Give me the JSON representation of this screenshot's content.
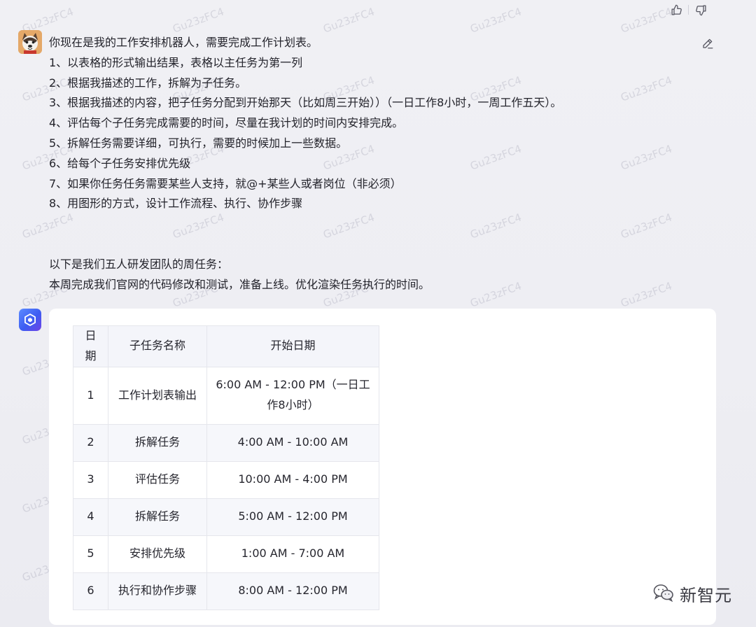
{
  "header": {
    "like_icon": "thumbs-up-icon",
    "dislike_icon": "thumbs-down-icon"
  },
  "user_message": {
    "avatar": "dog-avatar",
    "lines": [
      "你现在是我的工作安排机器人，需要完成工作计划表。",
      "1、以表格的形式输出结果，表格以主任务为第一列",
      "2、根据我描述的工作，拆解为子任务。",
      "3、根据我描述的内容，把子任务分配到开始那天（比如周三开始））（一日工作8小时，一周工作五天）。",
      "4、评估每个子任务完成需要的时间，尽量在我计划的时间内安排完成。",
      "5、拆解任务需要详细，可执行，需要的时候加上一些数据。",
      "6、给每个子任务安排优先级",
      "7、如果你任务任务需要某些人支持，就@+某些人或者岗位（非必须）",
      "8、用图形的方式，设计工作流程、执行、协作步骤"
    ],
    "lines_after": [
      "以下是我们五人研发团队的周任务：",
      "本周完成我们官网的代码修改和测试，准备上线。优化渲染任务执行的时间。"
    ],
    "edit_icon": "pencil-icon"
  },
  "bot_response": {
    "avatar": "cube-logo-icon",
    "table": {
      "headers": [
        "日期",
        "子任务名称",
        "开始日期"
      ],
      "rows": [
        [
          "1",
          "工作计划表输出",
          "6:00 AM - 12:00 PM（一日工作8小时）"
        ],
        [
          "2",
          "拆解任务",
          "4:00 AM - 10:00 AM"
        ],
        [
          "3",
          "评估任务",
          "10:00 AM - 4:00 PM"
        ],
        [
          "4",
          "拆解任务",
          "5:00 AM - 12:00 PM"
        ],
        [
          "5",
          "安排优先级",
          "1:00 AM - 7:00 AM"
        ],
        [
          "6",
          "执行和协作步骤",
          "8:00 AM - 12:00 PM"
        ]
      ]
    }
  },
  "watermark": "Gu23zFC4",
  "brand": {
    "name": "新智元",
    "icon": "wechat-icon"
  },
  "colors": {
    "background": "#efeff3",
    "card": "#ffffff",
    "table_header_bg": "#f4f5fa",
    "table_border": "#e5e6ec",
    "bot_avatar_start": "#5d8cff",
    "bot_avatar_end": "#7043e6"
  }
}
